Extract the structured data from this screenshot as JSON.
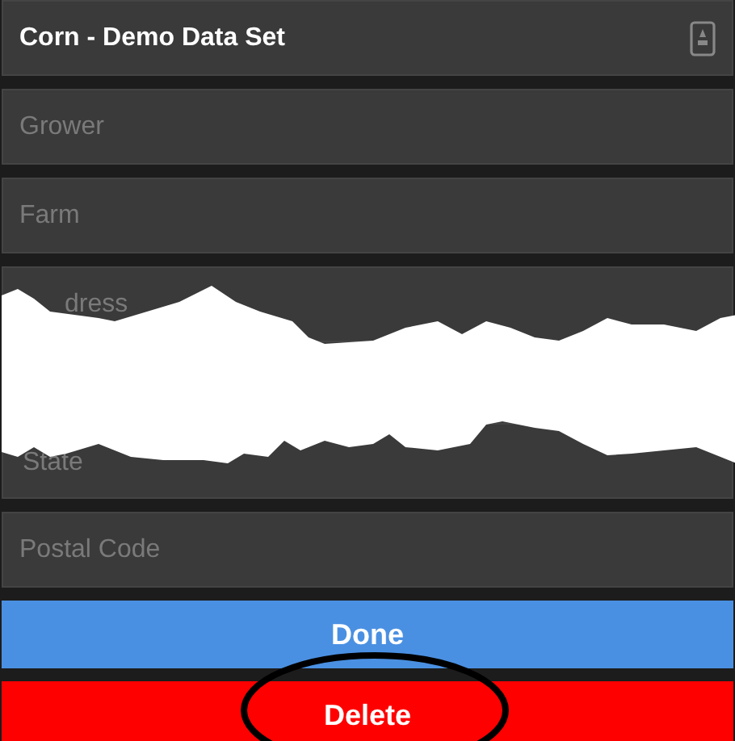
{
  "header": {
    "title": "Corn - Demo Data Set"
  },
  "fields": [
    {
      "placeholder": "Grower"
    },
    {
      "placeholder": "Farm"
    }
  ],
  "torn_fields": [
    {
      "placeholder": "dress"
    },
    {
      "placeholder": "State"
    }
  ],
  "postal_field": {
    "placeholder": "Postal Code"
  },
  "buttons": [
    {
      "label": "Done",
      "kind": "primary",
      "circled": false
    },
    {
      "label": "Delete",
      "kind": "danger",
      "circled": true
    }
  ]
}
